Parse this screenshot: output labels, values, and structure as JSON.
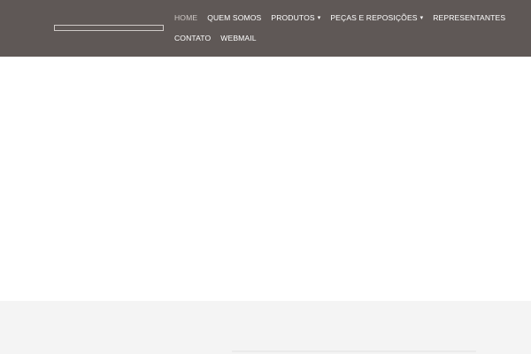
{
  "nav": {
    "items": [
      {
        "label": "HOME",
        "active": true
      },
      {
        "label": "QUEM SOMOS"
      },
      {
        "label": "PRODUTOS",
        "has_dropdown": true,
        "icon": "chevron-down-icon"
      },
      {
        "label": "PEÇAS E REPOSIÇÕES",
        "has_dropdown": true,
        "icon": "chevron-down-icon"
      },
      {
        "label": "REPRESENTANTES"
      },
      {
        "label": "CONTATO"
      },
      {
        "label": "WEBMAIL"
      }
    ]
  },
  "colors": {
    "header_bg": "#5f5856",
    "nav_text": "#ffffff",
    "nav_active": "#cfc9c6",
    "footer_bg": "#f4f4f4"
  },
  "icons": {
    "caret": "▾"
  }
}
